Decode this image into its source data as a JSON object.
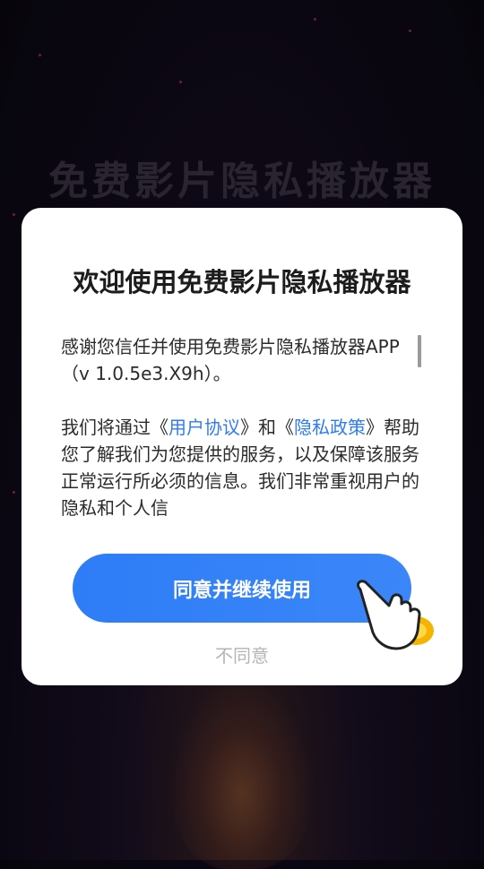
{
  "background": {
    "app_name": "免费影片隐私播放器"
  },
  "dialog": {
    "title": "欢迎使用免费影片隐私播放器",
    "paragraph1": "感谢您信任并使用免费影片隐私播放器APP（v 1.0.5e3.X9h）。",
    "p2_before": "我们将通过《",
    "user_agreement_link": "用户协议",
    "p2_mid": "》和《",
    "privacy_policy_link": "隐私政策",
    "p2_after": "》帮助您了解我们为您提供的服务，以及保障该服务正常运行所必须的信息。我们非常重视用户的隐私和个人信",
    "agree_button": "同意并继续使用",
    "disagree_button": "不同意",
    "hand_icon": "pointing-hand-icon"
  },
  "colors": {
    "accent": "#2f7bf5",
    "button": "#3382f7",
    "dialog_bg": "#ffffff",
    "page_bg": "#0b0712"
  }
}
